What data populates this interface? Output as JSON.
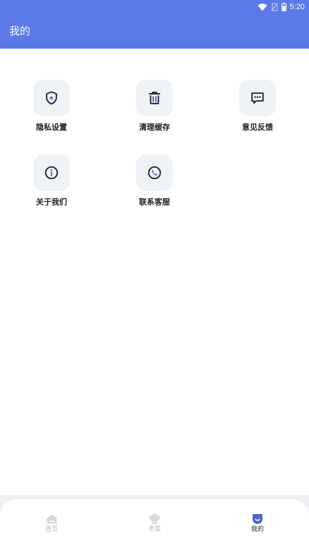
{
  "status_bar": {
    "time": "5:20",
    "icons": [
      "wifi-icon",
      "no-sim-icon",
      "battery-icon"
    ]
  },
  "app_bar": {
    "title": "我的"
  },
  "menu": {
    "items": [
      {
        "label": "隐私设置",
        "icon": "shield-icon"
      },
      {
        "label": "清理缓存",
        "icon": "trash-icon"
      },
      {
        "label": "意见反馈",
        "icon": "message-icon"
      },
      {
        "label": "关于我们",
        "icon": "info-icon"
      },
      {
        "label": "联系客服",
        "icon": "phone-icon"
      }
    ]
  },
  "tab_bar": {
    "tabs": [
      {
        "label": "首页",
        "icon": "home-icon",
        "active": false
      },
      {
        "label": "考菜",
        "icon": "chef-hat-icon",
        "active": false
      },
      {
        "label": "我的",
        "icon": "profile-icon",
        "active": true
      }
    ]
  },
  "colors": {
    "primary": "#5b79e8",
    "tile_background": "#eff2f7",
    "tab_inactive": "#b5b8be",
    "tab_active": "#2a2d33"
  }
}
